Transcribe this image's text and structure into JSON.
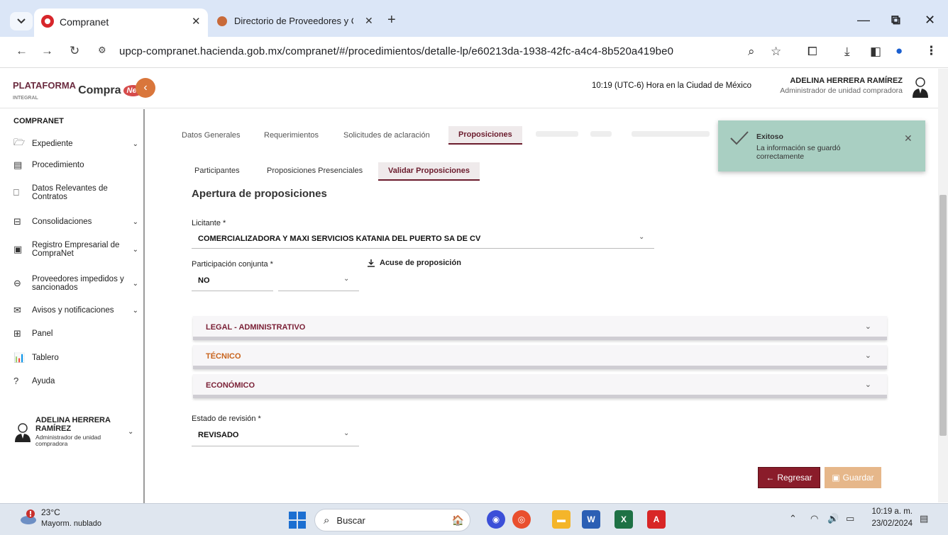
{
  "browser": {
    "tab1_title": "Compranet",
    "tab2_title": "Directorio de Proveedores y C",
    "url": "upcp-compranet.hacienda.gob.mx/compranet/#/procedimientos/detalle-lp/e60213da-1938-42fc-a4c4-8b520a419be0"
  },
  "header": {
    "logo_text": "Compra",
    "logo_prefix": "PLATAFORMA",
    "logo_sub": "INTEGRAL",
    "logo_badge": "Net",
    "clock": "10:19 (UTC-6) Hora en la Ciudad de México",
    "user_name": "ADELINA HERRERA RAMÍREZ",
    "user_role": "Administrador de unidad compradora"
  },
  "sidebar": {
    "title": "COMPRANET",
    "items": [
      {
        "label": "Expediente"
      },
      {
        "label": "Procedimiento"
      },
      {
        "label": "Datos Relevantes de Contratos"
      },
      {
        "label": "Consolidaciones"
      },
      {
        "label": "Registro Empresarial de CompraNet"
      },
      {
        "label": "Proveedores impedidos y sancionados"
      },
      {
        "label": "Avisos y notificaciones"
      },
      {
        "label": "Panel"
      },
      {
        "label": "Tablero"
      },
      {
        "label": "Ayuda"
      }
    ],
    "user_name": "ADELINA HERRERA RAMÍREZ",
    "user_role": "Administrador de unidad compradora"
  },
  "main": {
    "tabs": [
      "Datos Generales",
      "Requerimientos",
      "Solicitudes de aclaración",
      "Proposiciones"
    ],
    "subtabs": [
      "Participantes",
      "Proposiciones Presenciales",
      "Validar Proposiciones"
    ],
    "section_title": "Apertura de proposiciones",
    "licitante_label": "Licitante *",
    "licitante_value": "COMERCIALIZADORA Y MAXI SERVICIOS KATANIA DEL PUERTO SA DE CV",
    "participacion_label": "Participación conjunta *",
    "participacion_value": "NO",
    "acuse_label": "Acuse de proposición",
    "accordions": [
      {
        "label": "LEGAL - ADMINISTRATIVO",
        "color": "#7a1f35"
      },
      {
        "label": "TÉCNICO",
        "color": "#c8631c"
      },
      {
        "label": "ECONÓMICO",
        "color": "#7a1f35"
      }
    ],
    "estado_label": "Estado de revisión *",
    "estado_value": "REVISADO",
    "back_button": "Regresar",
    "save_button": "Guardar"
  },
  "toast": {
    "title": "Exitoso",
    "message": "La información se guardó correctamente"
  },
  "taskbar": {
    "temperature": "23°C",
    "weather": "Mayorm. nublado",
    "search_placeholder": "Buscar",
    "time": "10:19 a. m.",
    "date": "23/02/2024"
  },
  "colors": {
    "brand": "#6b1c2d",
    "accent_orange": "#d9763b",
    "toast_bg": "#a9cfc2"
  }
}
